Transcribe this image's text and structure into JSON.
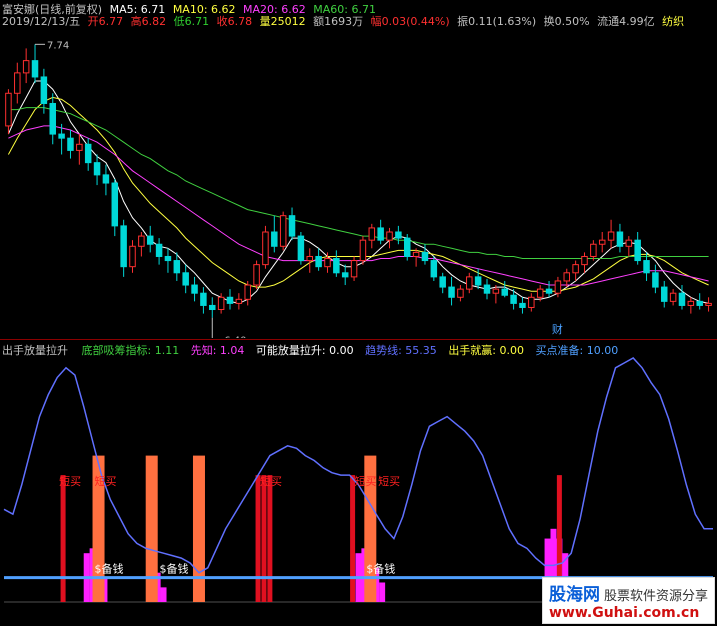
{
  "header": {
    "line1": {
      "stock_title": "富安娜(日线,前复权)",
      "ma5": "MA5: 6.71",
      "ma10": "MA10: 6.62",
      "ma20": "MA20: 6.62",
      "ma60": "MA60: 6.71"
    },
    "line2": {
      "date": "2019/12/13/五",
      "open": "开6.77",
      "high": "高6.82",
      "low": "低6.71",
      "close": "收6.78",
      "volume": "量25012",
      "amount": "额1693万",
      "change": "幅0.03(0.44%)",
      "amplitude": "振0.11(1.63%)",
      "turnover": "换0.50%",
      "float_cap": "流通4.99亿",
      "sector": "纺织"
    }
  },
  "indicator_header": {
    "name": "出手放量拉升",
    "bottom_label": "底部吸筹指标: 1.11",
    "foresight_label": "先知: 1.04",
    "volume_label": "可能放量拉升: 0.00",
    "trend_label": "趋势线: 55.35",
    "win_label": "出手就赢: 0.00",
    "buy_label": "买点准备: 10.00"
  },
  "colors": {
    "background": "#000000",
    "up_candle": "#ff3030",
    "down_candle": "#00d8d8",
    "ma5": "#ffffff",
    "ma10": "#ffff40",
    "ma20": "#ff40ff",
    "ma60": "#40d040",
    "trend": "#6070ff",
    "bar_red": "#e01020",
    "bar_orange": "#ff7040",
    "bar_magenta": "#ff20ff",
    "baseline": "#50a0ff"
  },
  "chart_data": [
    {
      "type": "candlestick",
      "title": "富安娜(日线,前复权)",
      "price_range": [
        6.32,
        7.82
      ],
      "annotations": [
        {
          "label": "7.74",
          "index": 3
        },
        {
          "label": "6.40",
          "index": 23
        },
        {
          "label": "财",
          "index": 62
        }
      ],
      "candles": [
        [
          7.34,
          7.52,
          7.3,
          7.5
        ],
        [
          7.5,
          7.65,
          7.45,
          7.6
        ],
        [
          7.6,
          7.72,
          7.55,
          7.66
        ],
        [
          7.66,
          7.74,
          7.55,
          7.58
        ],
        [
          7.58,
          7.62,
          7.4,
          7.45
        ],
        [
          7.45,
          7.5,
          7.25,
          7.3
        ],
        [
          7.3,
          7.35,
          7.2,
          7.28
        ],
        [
          7.28,
          7.32,
          7.18,
          7.22
        ],
        [
          7.22,
          7.3,
          7.15,
          7.25
        ],
        [
          7.25,
          7.28,
          7.12,
          7.16
        ],
        [
          7.16,
          7.2,
          7.05,
          7.1
        ],
        [
          7.1,
          7.15,
          7.0,
          7.06
        ],
        [
          7.06,
          7.08,
          6.8,
          6.85
        ],
        [
          6.85,
          6.88,
          6.6,
          6.65
        ],
        [
          6.65,
          6.78,
          6.62,
          6.75
        ],
        [
          6.75,
          6.82,
          6.7,
          6.8
        ],
        [
          6.8,
          6.85,
          6.72,
          6.76
        ],
        [
          6.76,
          6.79,
          6.66,
          6.7
        ],
        [
          6.7,
          6.74,
          6.62,
          6.68
        ],
        [
          6.68,
          6.72,
          6.58,
          6.62
        ],
        [
          6.62,
          6.66,
          6.52,
          6.56
        ],
        [
          6.56,
          6.6,
          6.48,
          6.52
        ],
        [
          6.52,
          6.55,
          6.42,
          6.46
        ],
        [
          6.46,
          6.5,
          6.4,
          6.44
        ],
        [
          6.44,
          6.52,
          6.42,
          6.5
        ],
        [
          6.5,
          6.54,
          6.44,
          6.47
        ],
        [
          6.47,
          6.52,
          6.44,
          6.49
        ],
        [
          6.49,
          6.58,
          6.46,
          6.56
        ],
        [
          6.56,
          6.68,
          6.54,
          6.66
        ],
        [
          6.66,
          6.85,
          6.64,
          6.82
        ],
        [
          6.82,
          6.9,
          6.72,
          6.75
        ],
        [
          6.75,
          6.92,
          6.73,
          6.9
        ],
        [
          6.9,
          6.94,
          6.78,
          6.8
        ],
        [
          6.8,
          6.82,
          6.66,
          6.68
        ],
        [
          6.68,
          6.74,
          6.62,
          6.7
        ],
        [
          6.7,
          6.74,
          6.63,
          6.65
        ],
        [
          6.65,
          6.72,
          6.62,
          6.69
        ],
        [
          6.69,
          6.73,
          6.6,
          6.62
        ],
        [
          6.62,
          6.66,
          6.56,
          6.6
        ],
        [
          6.6,
          6.7,
          6.58,
          6.68
        ],
        [
          6.68,
          6.8,
          6.66,
          6.78
        ],
        [
          6.78,
          6.86,
          6.74,
          6.84
        ],
        [
          6.84,
          6.88,
          6.76,
          6.78
        ],
        [
          6.78,
          6.84,
          6.74,
          6.82
        ],
        [
          6.82,
          6.85,
          6.76,
          6.79
        ],
        [
          6.79,
          6.81,
          6.68,
          6.7
        ],
        [
          6.7,
          6.74,
          6.65,
          6.72
        ],
        [
          6.72,
          6.76,
          6.66,
          6.68
        ],
        [
          6.68,
          6.7,
          6.58,
          6.6
        ],
        [
          6.6,
          6.62,
          6.52,
          6.55
        ],
        [
          6.55,
          6.6,
          6.46,
          6.5
        ],
        [
          6.5,
          6.56,
          6.48,
          6.54
        ],
        [
          6.54,
          6.62,
          6.52,
          6.6
        ],
        [
          6.6,
          6.64,
          6.54,
          6.56
        ],
        [
          6.56,
          6.59,
          6.49,
          6.52
        ],
        [
          6.52,
          6.56,
          6.47,
          6.54
        ],
        [
          6.54,
          6.58,
          6.5,
          6.51
        ],
        [
          6.51,
          6.54,
          6.44,
          6.47
        ],
        [
          6.47,
          6.5,
          6.42,
          6.45
        ],
        [
          6.45,
          6.52,
          6.43,
          6.5
        ],
        [
          6.5,
          6.56,
          6.48,
          6.54
        ],
        [
          6.54,
          6.58,
          6.5,
          6.52
        ],
        [
          6.52,
          6.6,
          6.5,
          6.58
        ],
        [
          6.58,
          6.64,
          6.55,
          6.62
        ],
        [
          6.62,
          6.68,
          6.58,
          6.66
        ],
        [
          6.66,
          6.72,
          6.62,
          6.7
        ],
        [
          6.7,
          6.78,
          6.68,
          6.76
        ],
        [
          6.76,
          6.82,
          6.72,
          6.78
        ],
        [
          6.78,
          6.88,
          6.74,
          6.82
        ],
        [
          6.82,
          6.86,
          6.72,
          6.75
        ],
        [
          6.75,
          6.8,
          6.7,
          6.78
        ],
        [
          6.78,
          6.82,
          6.66,
          6.68
        ],
        [
          6.68,
          6.72,
          6.58,
          6.62
        ],
        [
          6.62,
          6.66,
          6.52,
          6.55
        ],
        [
          6.55,
          6.58,
          6.45,
          6.48
        ],
        [
          6.48,
          6.54,
          6.46,
          6.52
        ],
        [
          6.52,
          6.56,
          6.44,
          6.46
        ],
        [
          6.46,
          6.5,
          6.42,
          6.48
        ],
        [
          6.48,
          6.52,
          6.44,
          6.46
        ],
        [
          6.46,
          6.5,
          6.43,
          6.47
        ]
      ],
      "ma_series": [
        {
          "name": "MA5",
          "values": [
            7.3,
            7.4,
            7.48,
            7.56,
            7.56,
            7.52,
            7.45,
            7.36,
            7.3,
            7.24,
            7.19,
            7.16,
            7.08,
            6.97,
            6.89,
            6.84,
            6.78,
            6.75,
            6.74,
            6.71,
            6.66,
            6.62,
            6.57,
            6.52,
            6.5,
            6.48,
            6.47,
            6.49,
            6.53,
            6.6,
            6.66,
            6.72,
            6.79,
            6.79,
            6.77,
            6.74,
            6.7,
            6.67,
            6.65,
            6.65,
            6.67,
            6.7,
            6.74,
            6.78,
            6.8,
            6.79,
            6.76,
            6.74,
            6.7,
            6.65,
            6.61,
            6.58,
            6.56,
            6.55,
            6.54,
            6.55,
            6.55,
            6.53,
            6.5,
            6.49,
            6.49,
            6.5,
            6.52,
            6.55,
            6.58,
            6.62,
            6.66,
            6.7,
            6.74,
            6.76,
            6.77,
            6.76,
            6.72,
            6.68,
            6.62,
            6.57,
            6.53,
            6.5,
            6.48,
            6.47
          ]
        },
        {
          "name": "MA10",
          "values": [
            7.2,
            7.28,
            7.35,
            7.42,
            7.46,
            7.48,
            7.47,
            7.44,
            7.4,
            7.36,
            7.32,
            7.27,
            7.21,
            7.13,
            7.06,
            7.01,
            6.96,
            6.92,
            6.88,
            6.84,
            6.79,
            6.75,
            6.71,
            6.67,
            6.64,
            6.61,
            6.58,
            6.56,
            6.55,
            6.55,
            6.56,
            6.58,
            6.61,
            6.64,
            6.67,
            6.69,
            6.7,
            6.7,
            6.7,
            6.7,
            6.7,
            6.7,
            6.71,
            6.72,
            6.73,
            6.73,
            6.73,
            6.72,
            6.71,
            6.7,
            6.68,
            6.66,
            6.64,
            6.62,
            6.6,
            6.58,
            6.56,
            6.55,
            6.54,
            6.53,
            6.53,
            6.53,
            6.53,
            6.54,
            6.55,
            6.57,
            6.59,
            6.62,
            6.65,
            6.68,
            6.7,
            6.71,
            6.71,
            6.7,
            6.68,
            6.65,
            6.62,
            6.6,
            6.58,
            6.56
          ]
        },
        {
          "name": "MA20",
          "values": [
            7.28,
            7.3,
            7.32,
            7.33,
            7.34,
            7.34,
            7.33,
            7.32,
            7.3,
            7.28,
            7.26,
            7.23,
            7.2,
            7.16,
            7.12,
            7.09,
            7.06,
            7.03,
            7.0,
            6.97,
            6.94,
            6.91,
            6.88,
            6.85,
            6.82,
            6.79,
            6.76,
            6.74,
            6.72,
            6.7,
            6.69,
            6.68,
            6.68,
            6.68,
            6.68,
            6.68,
            6.68,
            6.68,
            6.68,
            6.68,
            6.68,
            6.68,
            6.69,
            6.69,
            6.7,
            6.7,
            6.7,
            6.69,
            6.69,
            6.68,
            6.67,
            6.66,
            6.65,
            6.64,
            6.63,
            6.62,
            6.61,
            6.6,
            6.59,
            6.58,
            6.57,
            6.56,
            6.56,
            6.56,
            6.56,
            6.56,
            6.57,
            6.58,
            6.59,
            6.6,
            6.61,
            6.62,
            6.63,
            6.63,
            6.63,
            6.62,
            6.61,
            6.6,
            6.59,
            6.58
          ]
        },
        {
          "name": "MA60",
          "values": [
            7.42,
            7.42,
            7.43,
            7.43,
            7.43,
            7.42,
            7.41,
            7.4,
            7.38,
            7.36,
            7.34,
            7.32,
            7.29,
            7.26,
            7.23,
            7.2,
            7.18,
            7.15,
            7.12,
            7.1,
            7.07,
            7.05,
            7.03,
            7.01,
            6.99,
            6.97,
            6.95,
            6.93,
            6.92,
            6.91,
            6.9,
            6.89,
            6.88,
            6.87,
            6.86,
            6.85,
            6.84,
            6.83,
            6.82,
            6.81,
            6.8,
            6.8,
            6.79,
            6.79,
            6.78,
            6.78,
            6.77,
            6.76,
            6.76,
            6.75,
            6.74,
            6.73,
            6.72,
            6.72,
            6.71,
            6.71,
            6.7,
            6.7,
            6.69,
            6.69,
            6.69,
            6.69,
            6.69,
            6.69,
            6.69,
            6.69,
            6.69,
            6.69,
            6.69,
            6.7,
            6.7,
            6.7,
            6.7,
            6.7,
            6.7,
            6.7,
            6.7,
            6.7,
            6.7,
            6.7
          ]
        }
      ]
    },
    {
      "type": "indicator",
      "title": "出手放量拉升",
      "y_range": [
        0,
        100
      ],
      "baseline": 10,
      "trend_line": [
        38,
        36,
        48,
        62,
        76,
        85,
        92,
        96,
        93,
        80,
        66,
        52,
        42,
        35,
        28,
        24,
        22,
        21,
        20,
        19,
        18,
        16,
        12,
        14,
        22,
        30,
        36,
        42,
        48,
        54,
        60,
        62,
        64,
        63,
        60,
        58,
        55,
        53,
        52,
        52,
        48,
        42,
        36,
        30,
        26,
        35,
        48,
        62,
        72,
        74,
        76,
        73,
        70,
        66,
        60,
        50,
        40,
        30,
        24,
        22,
        18,
        15,
        15,
        16,
        20,
        34,
        52,
        70,
        84,
        96,
        98,
        100,
        96,
        90,
        85,
        75,
        62,
        48,
        36,
        30,
        30
      ],
      "tall_bars": [
        {
          "index": 10,
          "value": 52,
          "color": "red"
        },
        {
          "index": 16,
          "value": 60,
          "color": "orange"
        },
        {
          "index": 25,
          "value": 60,
          "color": "orange"
        },
        {
          "index": 33,
          "value": 60,
          "color": "orange"
        },
        {
          "index": 43,
          "value": 52,
          "color": "red"
        },
        {
          "index": 44,
          "value": 52,
          "color": "red"
        },
        {
          "index": 45,
          "value": 52,
          "color": "red"
        },
        {
          "index": 59,
          "value": 52,
          "color": "red"
        },
        {
          "index": 62,
          "value": 60,
          "color": "orange"
        },
        {
          "index": 94,
          "value": 52,
          "color": "red"
        }
      ],
      "magenta_bars": [
        {
          "index": 14,
          "value": 20
        },
        {
          "index": 15,
          "value": 22
        },
        {
          "index": 16,
          "value": 16
        },
        {
          "index": 17,
          "value": 10
        },
        {
          "index": 25,
          "value": 16
        },
        {
          "index": 26,
          "value": 12
        },
        {
          "index": 27,
          "value": 6
        },
        {
          "index": 60,
          "value": 20
        },
        {
          "index": 61,
          "value": 22
        },
        {
          "index": 62,
          "value": 18
        },
        {
          "index": 63,
          "value": 14
        },
        {
          "index": 64,
          "value": 8
        },
        {
          "index": 92,
          "value": 26
        },
        {
          "index": 93,
          "value": 30
        },
        {
          "index": 94,
          "value": 26
        },
        {
          "index": 95,
          "value": 20
        }
      ],
      "labels": [
        {
          "text": "短买",
          "index": 10
        },
        {
          "text": "短买",
          "index": 16
        },
        {
          "text": "$备钱",
          "index": 16
        },
        {
          "text": "$备钱",
          "index": 27
        },
        {
          "text": "短买",
          "index": 44
        },
        {
          "text": "短买",
          "index": 60
        },
        {
          "text": "短买",
          "index": 64
        },
        {
          "text": "$备钱",
          "index": 62
        }
      ]
    }
  ],
  "watermark": {
    "brand": "股海网",
    "slogan": "股票软件资源分享",
    "url": "www.Guhai.com.cn"
  }
}
